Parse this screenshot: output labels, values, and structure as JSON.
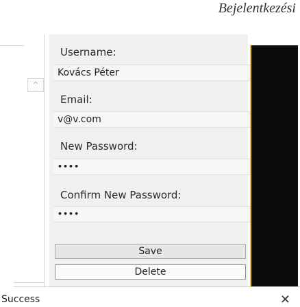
{
  "window": {
    "title": "Bejelentkezési"
  },
  "scroll": {
    "up_icon": "^"
  },
  "form": {
    "username_label": "Username:",
    "username_value": "Kovács Péter",
    "email_label": "Email:",
    "email_value": "v@v.com",
    "new_password_label": "New Password:",
    "new_password_value": "••••",
    "confirm_password_label": "Confirm New Password:",
    "confirm_password_value": "••••"
  },
  "buttons": {
    "save": "Save",
    "delete": "Delete"
  },
  "status": {
    "text": "Success",
    "close_icon": "✕"
  }
}
